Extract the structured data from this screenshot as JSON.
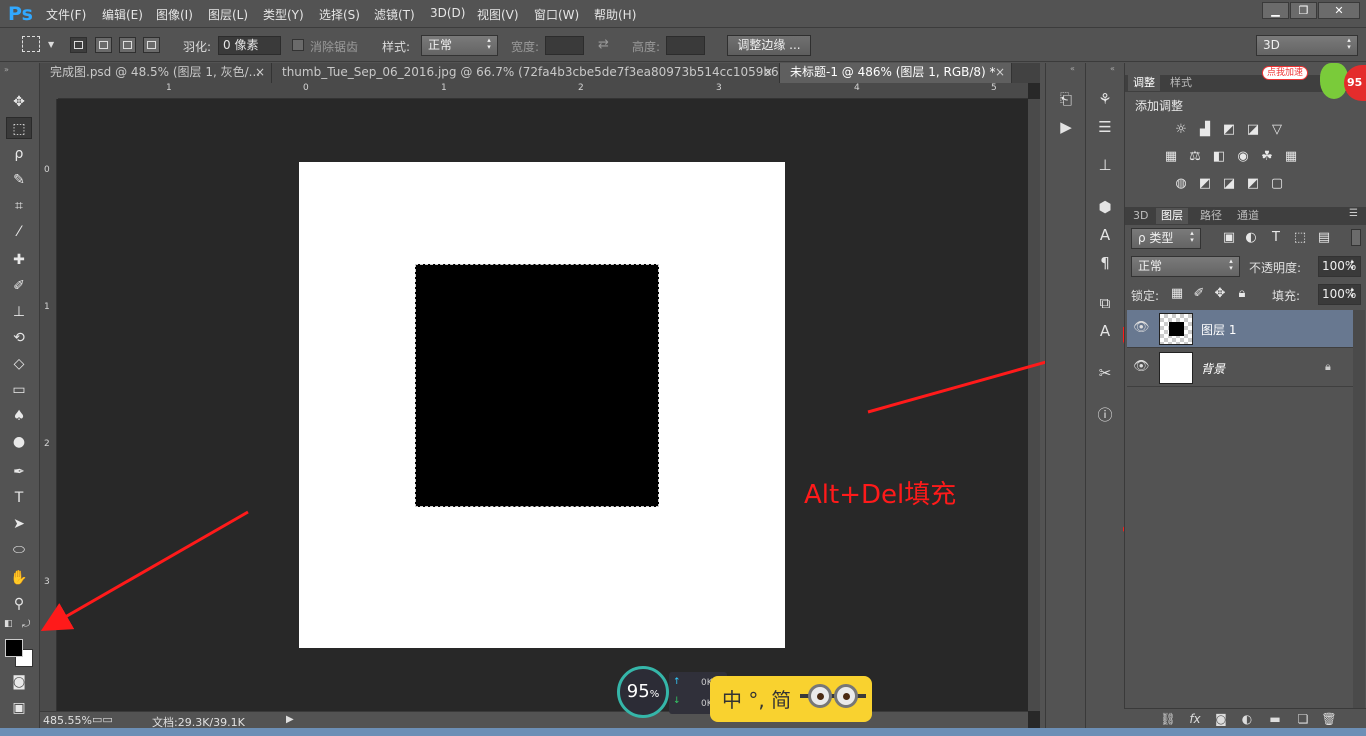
{
  "app": {
    "logo": "Ps"
  },
  "menu": [
    "文件(F)",
    "编辑(E)",
    "图像(I)",
    "图层(L)",
    "类型(Y)",
    "选择(S)",
    "滤镜(T)",
    "3D(D)",
    "视图(V)",
    "窗口(W)",
    "帮助(H)"
  ],
  "window_controls": {
    "minimize": "▁",
    "restore": "❐",
    "close": "✕"
  },
  "options": {
    "feather_label": "羽化:",
    "feather_value": "0 像素",
    "antialias_label": "消除锯齿",
    "style_label": "样式:",
    "style_value": "正常",
    "width_label": "宽度:",
    "height_label": "高度:",
    "refine_edge": "调整边缘 ...",
    "workspace": "3D"
  },
  "tabs": [
    {
      "label": "完成图.psd @ 48.5% (图层 1, 灰色/...",
      "close": "×"
    },
    {
      "label": "thumb_Tue_Sep_06_2016.jpg @ 66.7% (72fa4b3cbe5de7f3ea80973b514cc1059b6bb3...",
      "close": "×"
    },
    {
      "label": "未标题-1 @ 486% (图层 1, RGB/8) *",
      "close": "×"
    }
  ],
  "ruler": {
    "top": [
      "1",
      "0",
      "1",
      "2",
      "3",
      "4",
      "5"
    ],
    "left": [
      "0",
      "1",
      "2",
      "3"
    ]
  },
  "status": {
    "zoom": "485.55%",
    "doc": "文档:29.3K/39.1K"
  },
  "annotation": "Alt+Del填充",
  "adjustments": {
    "tab1": "调整",
    "tab2": "样式",
    "title": "添加调整"
  },
  "layers_panel": {
    "tabs": [
      "3D",
      "图层",
      "路径",
      "通道"
    ],
    "filter_label": "ρ 类型",
    "blend_mode": "正常",
    "opacity_label": "不透明度:",
    "opacity_value": "100%",
    "lock_label": "锁定:",
    "fill_label": "填充:",
    "fill_value": "100%",
    "layers": [
      {
        "name": "图层 1",
        "selected": true
      },
      {
        "name": "背景",
        "selected": false
      }
    ]
  },
  "widgets": {
    "speed_percent": "95",
    "speed_unit": "%",
    "up_speed": "0K/s",
    "down_speed": "0K/s",
    "ime_text": "中 °, 简",
    "badge_text": "点我加速",
    "badge_num": "95"
  },
  "colors": {
    "annotation": "#ff1a1a",
    "accent": "#31a8ff",
    "selected_layer": "#687890"
  }
}
